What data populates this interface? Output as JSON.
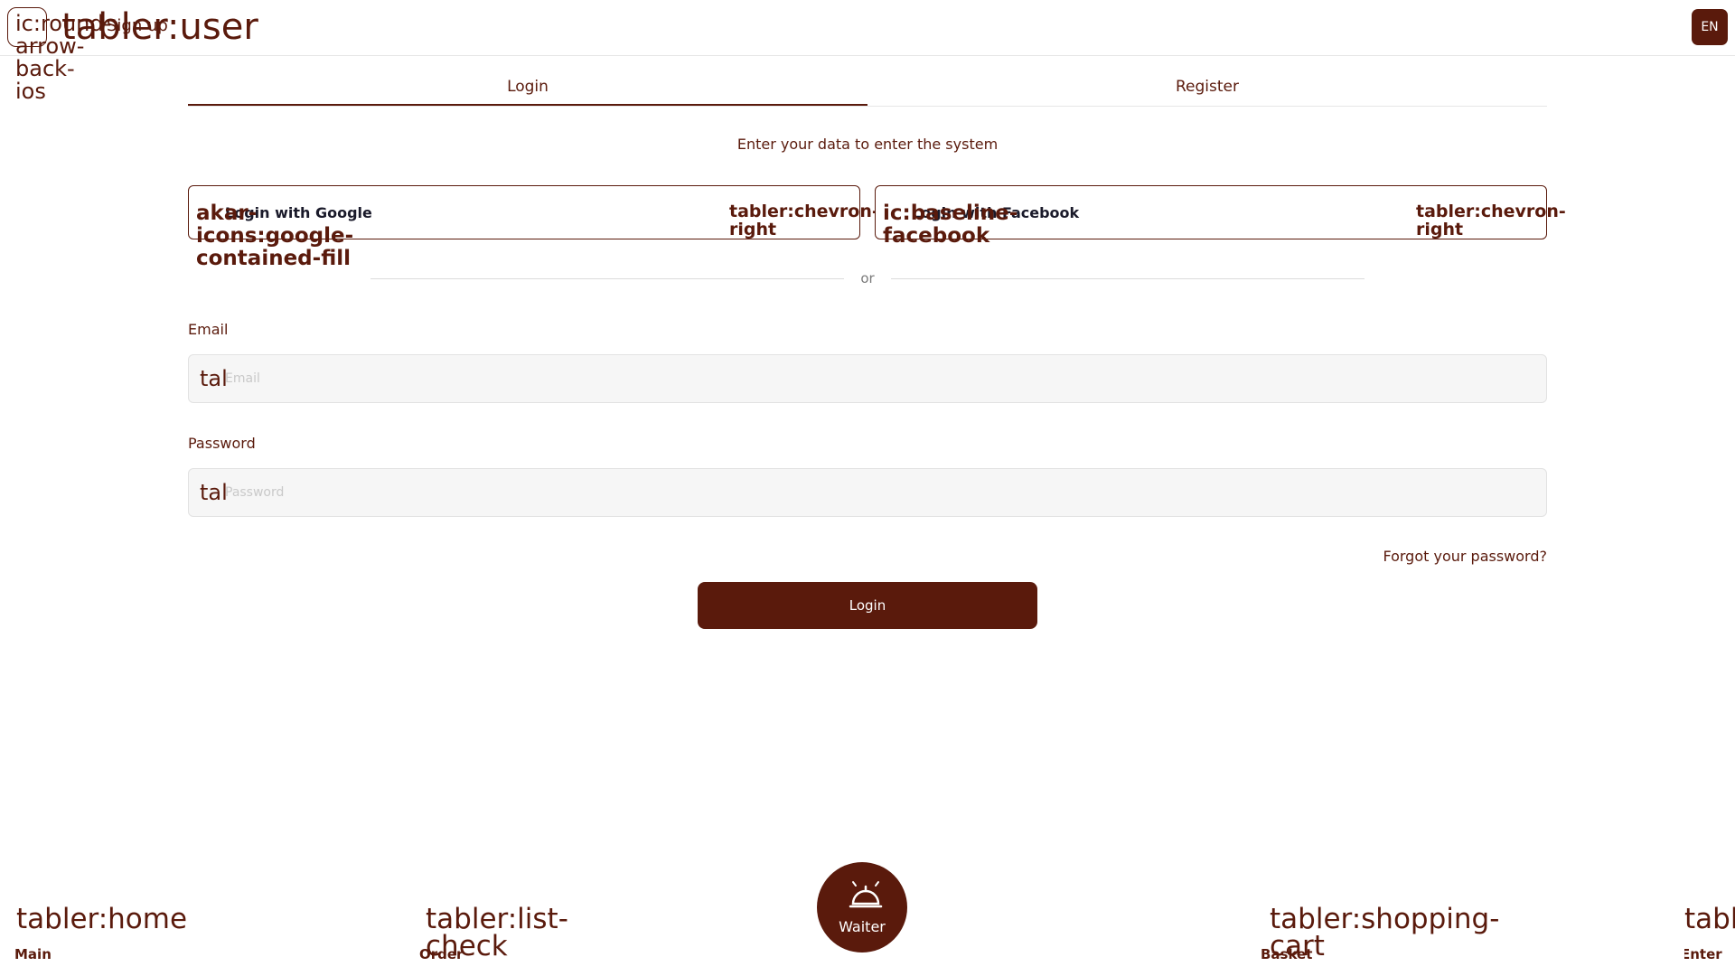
{
  "header": {
    "back_icon_label": "ic:round-arrow-back-ios",
    "user_icon_label": "tabler:user",
    "title": "Sign up",
    "language": "EN"
  },
  "tabs": [
    {
      "label": "Login",
      "active": true
    },
    {
      "label": "Register",
      "active": false
    }
  ],
  "subtitle": "Enter your data to enter the system",
  "social": {
    "google": {
      "icon": "akar-icons:google-contained-fill",
      "label": "Login with Google",
      "chevron": "tabler:chevron-right"
    },
    "facebook": {
      "icon": "ic:baseline-facebook",
      "label": "Login with Facebook",
      "chevron": "tabler:chevron-right"
    }
  },
  "divider_text": "or",
  "form": {
    "email": {
      "label": "Email",
      "placeholder": "Email",
      "icon": "tal"
    },
    "password": {
      "label": "Password",
      "placeholder": "Password",
      "icon": "tal"
    }
  },
  "forgot_password": "Forgot your password?",
  "login_button": "Login",
  "bottom_nav": [
    {
      "icon": "tabler:home",
      "label": "Main"
    },
    {
      "icon": "tabler:list-check",
      "label": "Order"
    },
    {
      "icon": "tabler:shopping-cart",
      "label": "Basket"
    },
    {
      "icon": "tabler:login",
      "label": "Enter"
    }
  ],
  "waiter": {
    "label": "Waiter",
    "icon": "bell-icon"
  },
  "colors": {
    "accent": "#5a1a0c",
    "background": "#ffffff"
  }
}
